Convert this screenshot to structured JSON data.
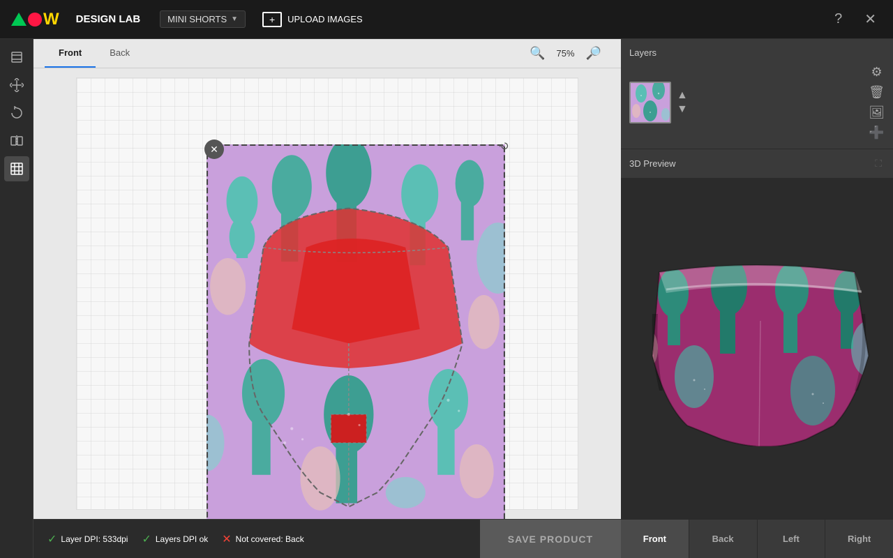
{
  "header": {
    "app_title": "DESIGN LAB",
    "product_name": "MINI SHORTS",
    "upload_btn_label": "UPLOAD IMAGES",
    "help_icon": "question-circle",
    "close_icon": "close"
  },
  "tabs": {
    "front_label": "Front",
    "back_label": "Back"
  },
  "canvas": {
    "zoom_level": "75%"
  },
  "preview_3d": {
    "label": "3D Preview"
  },
  "layers": {
    "title": "Layers"
  },
  "status_bar": {
    "dpi_label": "Layer DPI: 533dpi",
    "layers_ok_label": "Layers DPI ok",
    "not_covered_label": "Not covered: Back",
    "save_btn_label": "SAVE PRODUCT"
  },
  "view_buttons": {
    "front": "Front",
    "back": "Back",
    "left": "Left",
    "right": "Right"
  }
}
